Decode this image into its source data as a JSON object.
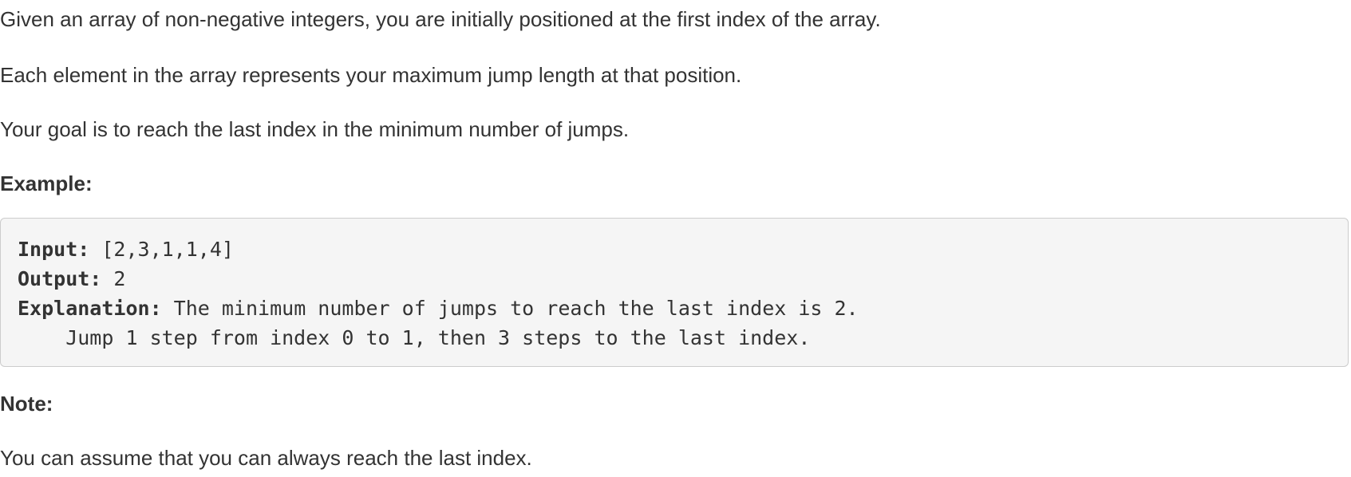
{
  "paragraphs": {
    "p1": "Given an array of non-negative integers, you are initially positioned at the first index of the array.",
    "p2": "Each element in the array represents your maximum jump length at that position.",
    "p3": "Your goal is to reach the last index in the minimum number of jumps."
  },
  "example": {
    "heading": "Example:",
    "input_key": "Input:",
    "input_value": " [2,3,1,1,4]",
    "output_key": "Output:",
    "output_value": " 2",
    "explanation_key": "Explanation:",
    "explanation_value": " The minimum number of jumps to reach the last index is 2.",
    "explanation_cont": "    Jump 1 step from index 0 to 1, then 3 steps to the last index."
  },
  "note": {
    "heading": "Note:",
    "text": "You can assume that you can always reach the last index."
  }
}
